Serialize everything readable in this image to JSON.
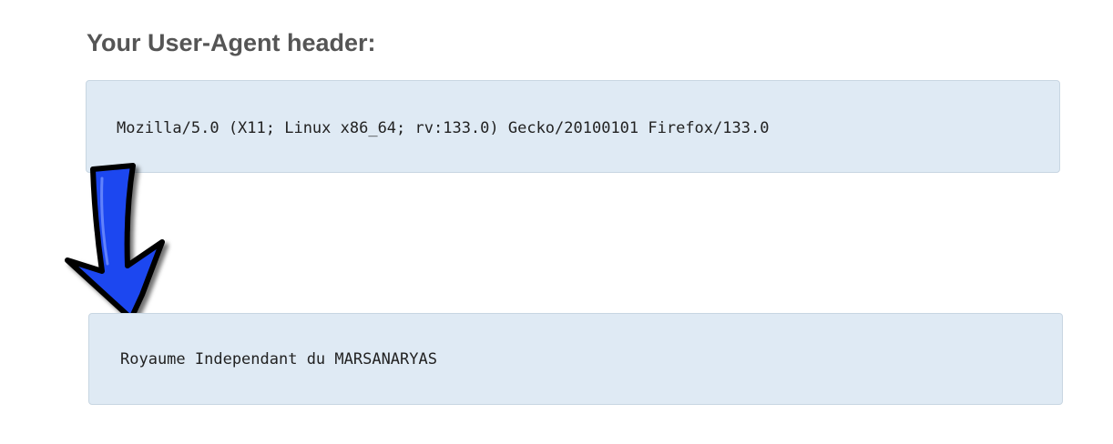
{
  "heading": "Your User-Agent header:",
  "user_agent": "Mozilla/5.0 (X11; Linux x86_64; rv:133.0) Gecko/20100101 Firefox/133.0",
  "result": "Royaume Independant du MARSANARYAS",
  "arrow": {
    "icon": "down-arrow-icon",
    "fill": "#1f47f0",
    "outline": "#000000"
  },
  "colors": {
    "box_background": "#dfeaf4",
    "heading_text": "#555555"
  }
}
